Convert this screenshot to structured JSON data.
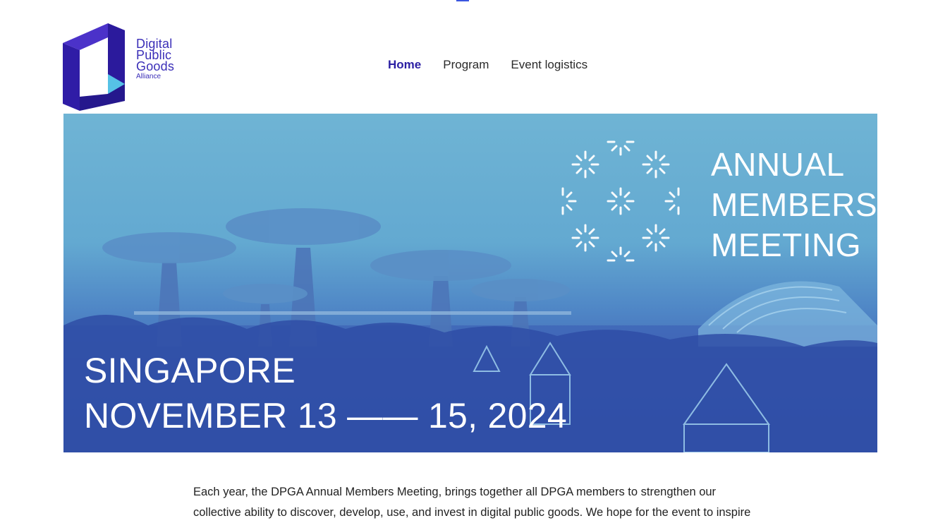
{
  "brand": {
    "logo_lines": [
      "Digital",
      "Public",
      "Goods"
    ],
    "logo_sub": "Alliance",
    "colors": {
      "primary": "#2b1fa3",
      "accent": "#56c2e6"
    }
  },
  "nav": {
    "items": [
      {
        "label": "Home",
        "active": true
      },
      {
        "label": "Program",
        "active": false
      },
      {
        "label": "Event logistics",
        "active": false
      }
    ]
  },
  "hero": {
    "title_lines": [
      "ANNUAL",
      "MEMBERS",
      "MEETING"
    ],
    "location": "SINGAPORE",
    "dates": "NOVEMBER 13 —— 15, 2024"
  },
  "intro": {
    "text": "Each year, the DPGA Annual Members Meeting, brings together all DPGA members to strengthen our collective ability to discover, develop, use, and invest in digital public goods. We hope for the event to inspire"
  }
}
